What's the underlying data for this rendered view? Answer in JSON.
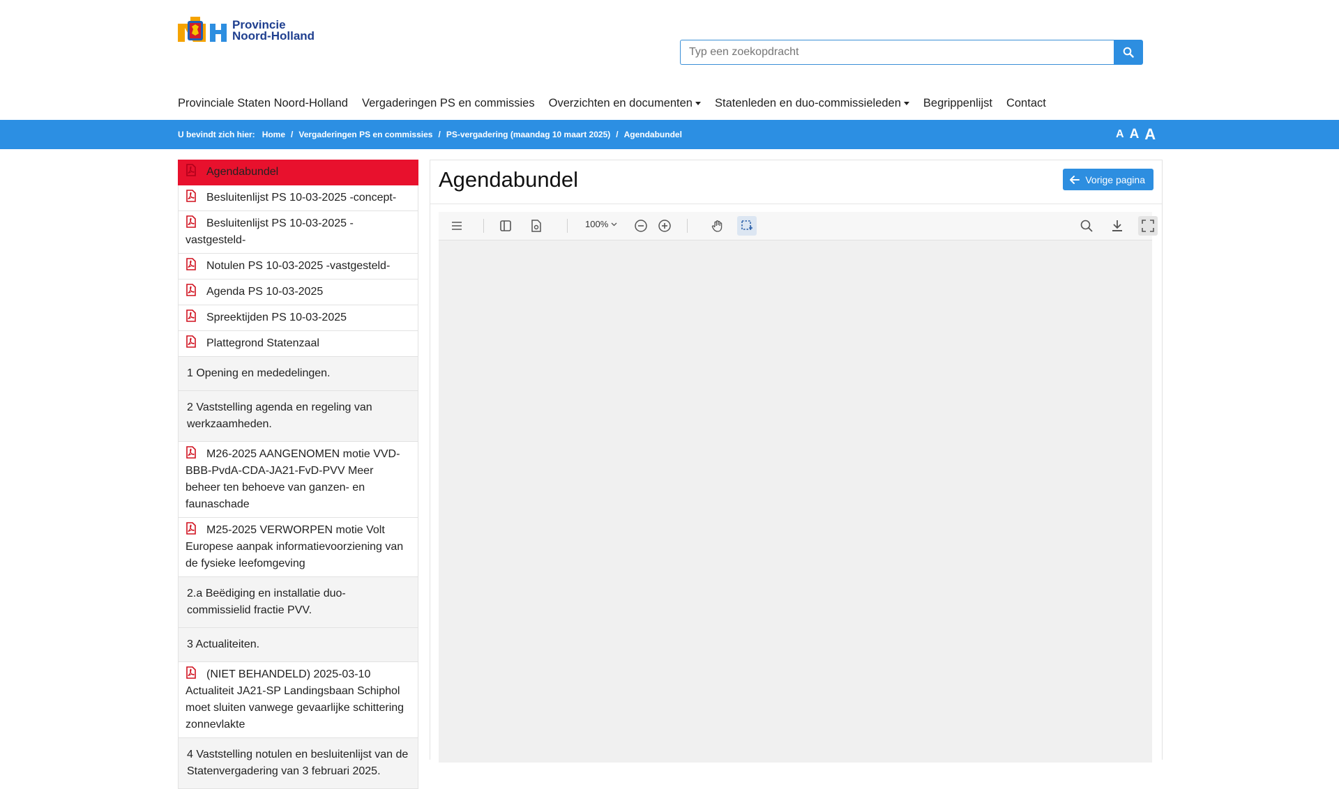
{
  "header": {
    "logo_line1": "Provincie",
    "logo_line2": "Noord-Holland",
    "search_placeholder": "Typ een zoekopdracht"
  },
  "nav": [
    {
      "label": "Provinciale Staten Noord-Holland",
      "dropdown": false
    },
    {
      "label": "Vergaderingen PS en commissies",
      "dropdown": false
    },
    {
      "label": "Overzichten en documenten",
      "dropdown": true
    },
    {
      "label": "Statenleden en duo-commissieleden",
      "dropdown": true
    },
    {
      "label": "Begrippenlijst",
      "dropdown": false
    },
    {
      "label": "Contact",
      "dropdown": false
    }
  ],
  "breadcrumb": {
    "lead": "U bevindt zich hier:",
    "items": [
      "Home",
      "Vergaderingen PS en commissies",
      "PS-vergadering (maandag 10 maart 2025)",
      "Agendabundel"
    ],
    "font_sizes": [
      "A",
      "A",
      "A"
    ]
  },
  "sidebar": {
    "documents": [
      {
        "label": "Agendabundel",
        "active": true
      },
      {
        "label": "Besluitenlijst PS 10-03-2025 -concept-"
      },
      {
        "label": "Besluitenlijst PS 10-03-2025 -vastgesteld-"
      },
      {
        "label": "Notulen PS 10-03-2025 -vastgesteld-"
      },
      {
        "label": "Agenda PS 10-03-2025"
      },
      {
        "label": "Spreektijden PS 10-03-2025"
      },
      {
        "label": "Plattegrond Statenzaal"
      }
    ],
    "agenda_1": "1 Opening en mededelingen.",
    "agenda_2": "2 Vaststelling agenda en regeling van werkzaamheden.",
    "doc_m26": "M26-2025 AANGENOMEN motie VVD-BBB-PvdA-CDA-JA21-FvD-PVV Meer beheer ten behoeve van ganzen- en faunaschade",
    "doc_m25": "M25-2025 VERWORPEN motie Volt Europese aanpak informatievoorziening van de fysieke leefomgeving",
    "agenda_2a": "2.a Beëdiging en installatie duo-commissielid fractie PVV.",
    "agenda_3": "3 Actualiteiten.",
    "doc_actualiteit": "(NIET BEHANDELD) 2025-03-10 Actualiteit JA21-SP Landingsbaan Schiphol moet sluiten vanwege gevaarlijke schittering zonnevlakte",
    "agenda_4": "4 Vaststelling notulen en besluitenlijst van de Statenvergadering van 3 februari 2025."
  },
  "main": {
    "title": "Agendabundel",
    "back_button": "Vorige pagina",
    "zoom_level": "100%"
  },
  "colors": {
    "brand_blue": "#2c8fe3",
    "active_red": "#e8112d",
    "pdf_red": "#d0101e"
  }
}
